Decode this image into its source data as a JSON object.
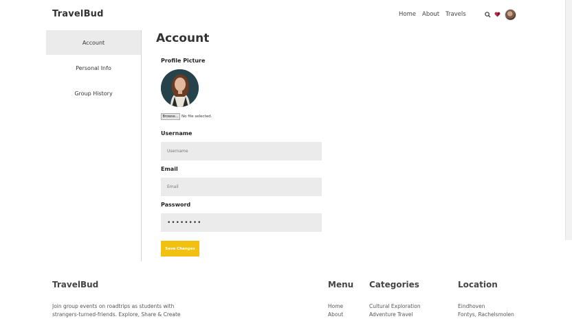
{
  "header": {
    "brand": "TravelBud",
    "nav": [
      "Home",
      "About",
      "Travels"
    ],
    "icons": [
      "search-icon",
      "heart-icon",
      "avatar"
    ]
  },
  "sidebar": {
    "items": [
      {
        "label": "Account",
        "active": true
      },
      {
        "label": "Personal Info",
        "active": false
      },
      {
        "label": "Group History",
        "active": false
      }
    ]
  },
  "main": {
    "title": "Account",
    "profile_label": "Profile Picture",
    "browse_label": "Browse...",
    "file_status": "No file selected.",
    "username_label": "Username",
    "username_placeholder": "Username",
    "email_label": "Email",
    "email_placeholder": "Email",
    "password_label": "Password",
    "password_value": "password",
    "save_label": "Save Changes"
  },
  "footer": {
    "brand": "TravelBud",
    "description_line1": "Join group events on roadtrips as students with",
    "description_line2": "strangers-turned-friends. Explore, Share & Create",
    "menu_title": "Menu",
    "menu_items": [
      "Home",
      "About"
    ],
    "categories_title": "Categories",
    "categories": [
      "Cultural Exploration",
      "Adventure Travel"
    ],
    "location_title": "Location",
    "location_lines": [
      "Eindhoven",
      "Fontys, Rachelsmolen"
    ]
  },
  "colors": {
    "accent": "#f2c00f",
    "field_bg": "#ebebeb",
    "sidebar_active": "#ebebeb"
  }
}
